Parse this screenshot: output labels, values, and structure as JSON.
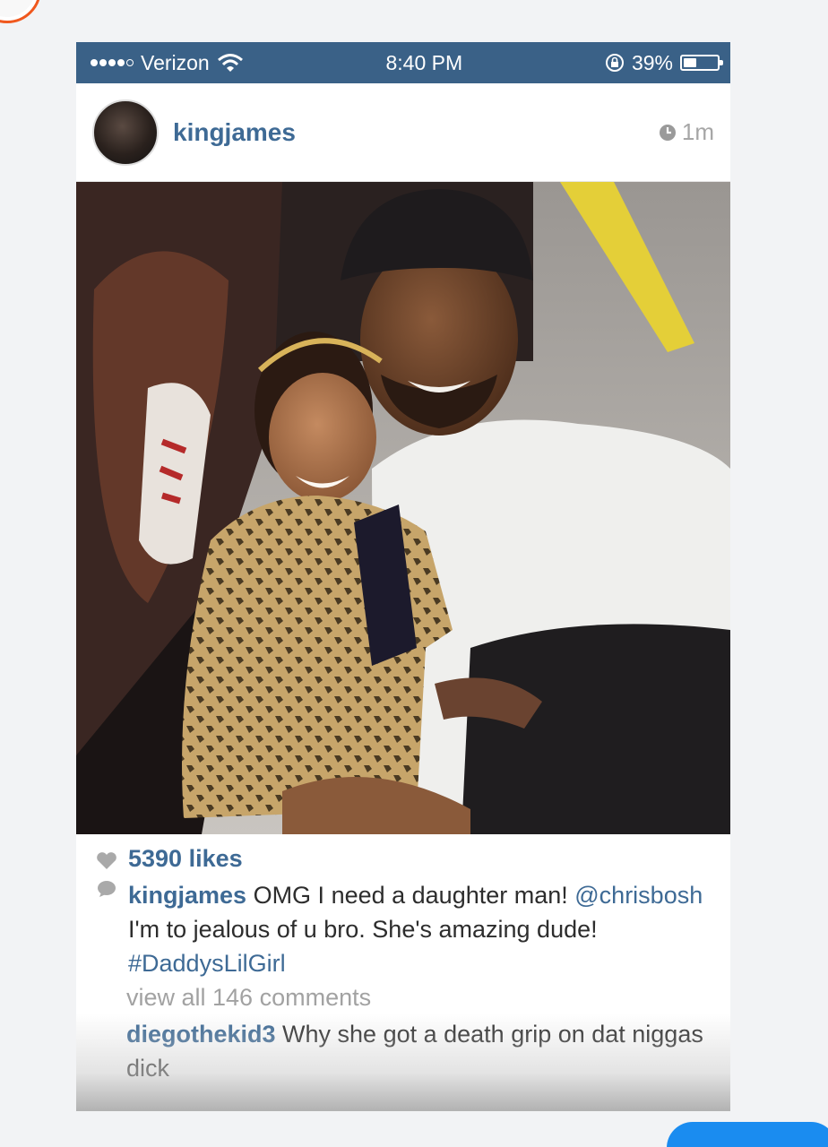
{
  "status_bar": {
    "carrier": "Verizon",
    "time": "8:40 PM",
    "battery": "39%",
    "battery_level": 0.39
  },
  "post": {
    "username": "kingjames",
    "age": "1m",
    "likes": "5390 likes",
    "caption": {
      "user": "kingjames",
      "text_1": " OMG I need a daughter man! ",
      "mention": "@chrisbosh",
      "text_2": " I'm to jealous of u bro. She's amazing dude! ",
      "hashtag": "#DaddysLilGirl"
    },
    "view_all": "view all 146 comments",
    "comments": [
      {
        "user": "diegothekid3",
        "text": " Why she got a death grip on dat niggas dick"
      }
    ]
  },
  "icons": {
    "signal": "signal-dots-icon",
    "wifi": "wifi-icon",
    "rotation_lock": "rotation-lock-icon",
    "battery": "battery-icon",
    "clock": "clock-icon",
    "heart": "heart-icon",
    "comment": "comment-bubble-icon"
  },
  "colors": {
    "status_bar": "#3a6187",
    "link": "#3e6a95",
    "muted": "#a6a6a6"
  }
}
